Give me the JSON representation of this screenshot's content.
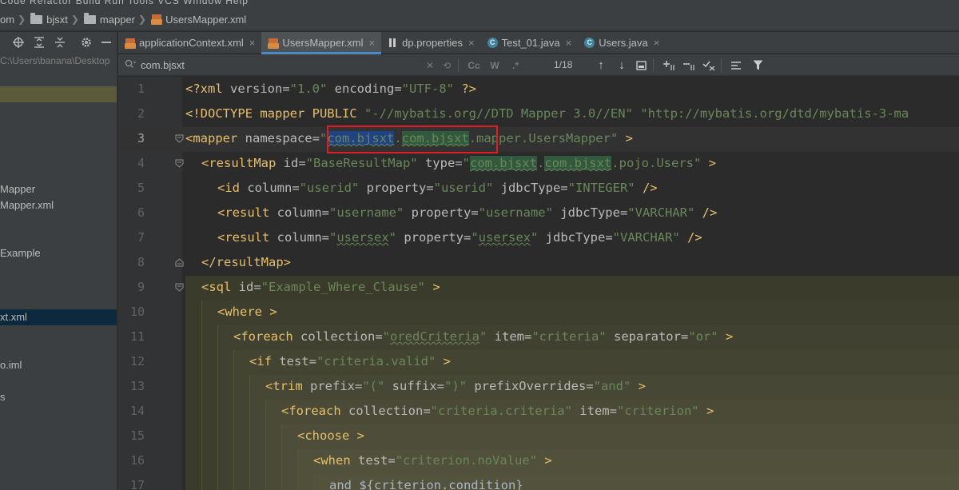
{
  "menubar": {
    "text": "Code  Refactor  Build  Run  Tools  VCS  Window  Help"
  },
  "breadcrumb": {
    "part1": "om",
    "part2": "bjsxt",
    "part3": "mapper",
    "file": "UsersMapper.xml"
  },
  "sidebar": {
    "path": "C:\\Users\\banana\\Desktop",
    "items": [
      {
        "label": "",
        "style": "olive"
      },
      {
        "label": "Mapper"
      },
      {
        "label": "Mapper.xml"
      },
      {
        "label": "Example"
      },
      {
        "label": "xt.xml",
        "style": "selected"
      },
      {
        "label": "o.iml"
      },
      {
        "label": "s"
      }
    ]
  },
  "tabs": [
    {
      "label": "applicationContext.xml",
      "icon": "xml-icon",
      "active": false
    },
    {
      "label": "UsersMapper.xml",
      "icon": "xml-icon",
      "active": true
    },
    {
      "label": "dp.properties",
      "icon": "properties-icon",
      "active": false
    },
    {
      "label": "Test_01.java",
      "icon": "class-icon",
      "active": false
    },
    {
      "label": "Users.java",
      "icon": "class-icon",
      "active": false
    }
  ],
  "icons": {
    "class": "C"
  },
  "find": {
    "query": "com.bjsxt",
    "match_case": "Cc",
    "words": "W",
    "regex": ".*",
    "count": "1/18"
  },
  "editor": {
    "current_line": 3,
    "lines": [
      {
        "n": "1"
      },
      {
        "n": "2"
      },
      {
        "n": "3"
      },
      {
        "n": "4"
      },
      {
        "n": "5"
      },
      {
        "n": "6"
      },
      {
        "n": "7"
      },
      {
        "n": "8"
      },
      {
        "n": "9"
      },
      {
        "n": "10"
      },
      {
        "n": "11"
      },
      {
        "n": "12"
      },
      {
        "n": "13"
      },
      {
        "n": "14"
      },
      {
        "n": "15"
      },
      {
        "n": "16"
      },
      {
        "n": "17"
      }
    ],
    "code": {
      "l1": {
        "open": "<?xml ",
        "a1": "version=",
        "v1": "\"1.0\"",
        "a2": " encoding=",
        "v2": "\"UTF-8\"",
        "close": " ?>"
      },
      "l2": {
        "open": "<!DOCTYPE mapper PUBLIC ",
        "v1": "\"-//mybatis.org//DTD Mapper 3.0//EN\"",
        "v2": " \"http://mybatis.org/dtd/mybatis-3-ma"
      },
      "l3": {
        "open": "<mapper ",
        "a1": "namespace=",
        "q": "\"",
        "sel": "com.bjsxt",
        "dot1": ".",
        "find": "com.bjsxt",
        "rest": ".mapper.UsersMapper\"",
        "close": " >"
      },
      "l4": {
        "open": "<resultMap ",
        "a1": "id=",
        "v1": "\"BaseResultMap\"",
        "a2": " type=",
        "q": "\"",
        "f1": "com.bjsxt",
        "dot": ".",
        "f2": "com.bjsxt",
        "rest": ".pojo.Users\"",
        "close": " >"
      },
      "l5": {
        "open": "<id ",
        "a1": "column=",
        "v1": "\"userid\"",
        "a2": " property=",
        "v2": "\"userid\"",
        "a3": " jdbcType=",
        "v3": "\"INTEGER\"",
        "close": " />"
      },
      "l6": {
        "open": "<result ",
        "a1": "column=",
        "v1": "\"username\"",
        "a2": " property=",
        "v2": "\"username\"",
        "a3": " jdbcType=",
        "v3": "\"VARCHAR\"",
        "close": " />"
      },
      "l7": {
        "open": "<result ",
        "a1": "column=",
        "q1": "\"",
        "u1": "usersex",
        "q2": "\"",
        "a2": " property=",
        "q3": "\"",
        "u2": "usersex",
        "q4": "\"",
        "a3": " jdbcType=",
        "v3": "\"VARCHAR\"",
        "close": " />"
      },
      "l8": {
        "tag": "</resultMap>"
      },
      "l9": {
        "open": "<sql ",
        "a1": "id=",
        "v1": "\"Example_Where_Clause\"",
        "close": " >"
      },
      "l10": {
        "tag": "<where >"
      },
      "l11": {
        "open": "<foreach ",
        "a1": "collection=",
        "q1": "\"",
        "u1": "oredCriteria",
        "q2": "\"",
        "a2": " item=",
        "v2": "\"criteria\"",
        "a3": " separator=",
        "v3": "\"or\"",
        "close": " >"
      },
      "l12": {
        "open": "<if ",
        "a1": "test=",
        "v1": "\"criteria.valid\"",
        "close": " >"
      },
      "l13": {
        "open": "<trim ",
        "a1": "prefix=",
        "v1": "\"(\"",
        "a2": " suffix=",
        "v2": "\")\"",
        "a3": " prefixOverrides=",
        "v3": "\"and\"",
        "close": " >"
      },
      "l14": {
        "open": "<foreach ",
        "a1": "collection=",
        "v1": "\"criteria.criteria\"",
        "a2": " item=",
        "v2": "\"criterion\"",
        "close": " >"
      },
      "l15": {
        "tag": "<choose >"
      },
      "l16": {
        "open": "<when ",
        "a1": "test=",
        "v1": "\"criterion.noValue\"",
        "close": " >"
      },
      "l17": {
        "text": "and ${criterion.condition}"
      }
    }
  }
}
